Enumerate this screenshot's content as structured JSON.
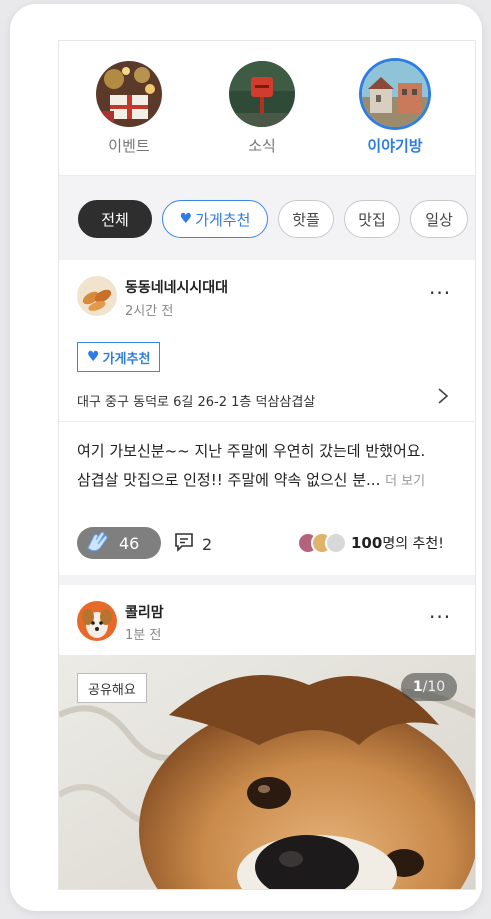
{
  "categories": [
    {
      "label": "이벤트",
      "icon": "gift-box-event-icon",
      "active": false
    },
    {
      "label": "소식",
      "icon": "mailbox-news-icon",
      "active": false
    },
    {
      "label": "이야기방",
      "icon": "story-room-icon",
      "active": true
    }
  ],
  "filters": {
    "all": "전체",
    "store_recommend": "가게추천",
    "hot_place": "핫플",
    "restaurant": "맛집",
    "daily": "일상"
  },
  "post1": {
    "author": "동동네네시시대대",
    "time": "2시간 전",
    "more": "···",
    "tag": "가게추천",
    "address": "대구 중구 동덕로 6길 26-2 1층 덕삼삼겹살",
    "text_line1": "여기 가보신분~~ 지난 주말에 우연히 갔는데 반했어요.",
    "text_line2": "삼겹살 맛집으로 인정!! 주말에 약속 없으신 분...",
    "see_more": "더 보기",
    "clap_count": "46",
    "comment_count": "2",
    "recommend_number": "100",
    "recommend_suffix": "명의 추천!"
  },
  "post2": {
    "author": "콜리맘",
    "time": "1분 전",
    "more": "···",
    "share_tag": "공유해요",
    "page_current": "1",
    "page_total": "/10"
  },
  "colors": {
    "accent": "#2f7de1",
    "dark_chip": "#2e2e2e",
    "background": "#e9e9ec"
  }
}
